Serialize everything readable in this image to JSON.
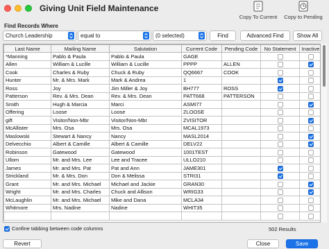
{
  "window": {
    "title": "Giving Unit Field Maintenance"
  },
  "toolbar": {
    "copy_current": "Copy To Current",
    "copy_pending": "Copy to Pending"
  },
  "find": {
    "label": "Find Records Where",
    "field": "Church Leadership",
    "operator": "equal to",
    "value": "(0 selected)",
    "find_button": "Find",
    "advanced_button": "Advanced Find",
    "show_all_button": "Show All"
  },
  "columns": [
    "Last Name",
    "Mailing Name",
    "Salutation",
    "Current Code",
    "Pending Code",
    "No Statement",
    "Inactive"
  ],
  "rows": [
    {
      "last": "*Manning",
      "mailing": "Pablo & Paula",
      "salutation": "Pablo & Paula",
      "current": "GAGE",
      "pending": "",
      "nostmt": false,
      "inactive": false
    },
    {
      "last": "Allen",
      "mailing": "William & Lucille",
      "salutation": "William & Lucille",
      "current": "PPPP",
      "pending": "ALLEN",
      "nostmt": false,
      "inactive": true
    },
    {
      "last": "Cook",
      "mailing": "Charles & Ruby",
      "salutation": "Chuck & Ruby",
      "current": "QQ6667",
      "pending": "COOK",
      "nostmt": false,
      "inactive": false
    },
    {
      "last": "Hunter",
      "mailing": "Mr. & Mrs. Mark",
      "salutation": "Mark & Andrea",
      "current": "1",
      "pending": "",
      "nostmt": true,
      "inactive": false
    },
    {
      "last": "Ross",
      "mailing": "Joy",
      "salutation": "Jim Miller & Joy",
      "current": "BH777",
      "pending": "ROSS",
      "nostmt": true,
      "inactive": false
    },
    {
      "last": "Patterson",
      "mailing": "Rev. & Mrs. Dean",
      "salutation": "Rev. & Mrs. Dean",
      "current": "PATT668",
      "pending": "PATTERSON",
      "nostmt": false,
      "inactive": false
    },
    {
      "last": "Smith",
      "mailing": "Hugh & Marcia",
      "salutation": "Marci",
      "current": "ASMI77",
      "pending": "",
      "nostmt": false,
      "inactive": true
    },
    {
      "last": "Offering",
      "mailing": "Loose",
      "salutation": "Loose",
      "current": "ZLOOSE",
      "pending": "",
      "nostmt": false,
      "inactive": false
    },
    {
      "last": "gift",
      "mailing": "Visitor/Non-Mbr",
      "salutation": "Visitor/Non-Mbr",
      "current": "ZVISITOR",
      "pending": "",
      "nostmt": false,
      "inactive": true
    },
    {
      "last": "McAllister",
      "mailing": "Mrs. Osa",
      "salutation": "Mrs. Osa",
      "current": "MCAL1973",
      "pending": "",
      "nostmt": false,
      "inactive": false
    },
    {
      "last": "Maslowski",
      "mailing": "Stewart & Nancy",
      "salutation": "Nancy",
      "current": "MASL2014",
      "pending": "",
      "nostmt": false,
      "inactive": true
    },
    {
      "last": "Delvecchio",
      "mailing": "Albert & Camille",
      "salutation": "Albert & Camille",
      "current": "DELV22",
      "pending": "",
      "nostmt": false,
      "inactive": true
    },
    {
      "last": "Robinson",
      "mailing": "Gatewood",
      "salutation": "Gatewood",
      "current": "1001TEST",
      "pending": "",
      "nostmt": false,
      "inactive": false
    },
    {
      "last": "Ullom",
      "mailing": "Mr. and Mrs. Lee",
      "salutation": "Lee and Tracee",
      "current": "ULLO210",
      "pending": "",
      "nostmt": false,
      "inactive": false
    },
    {
      "last": "James",
      "mailing": "Mr. and Mrs. Pat",
      "salutation": "Pat and Ann",
      "current": "JAME301",
      "pending": "",
      "nostmt": true,
      "inactive": false
    },
    {
      "last": "Strickland",
      "mailing": "Mr. & Mrs. Don",
      "salutation": "Don & Melissa",
      "current": "STRI31",
      "pending": "",
      "nostmt": true,
      "inactive": false
    },
    {
      "last": "Grant",
      "mailing": "Mr. and Mrs. Michael",
      "salutation": "Michael and Jackie",
      "current": "GRAN30",
      "pending": "",
      "nostmt": false,
      "inactive": true
    },
    {
      "last": "Wright",
      "mailing": "Mr. and Mrs. Charles",
      "salutation": "Chuck and Allison",
      "current": "WRIG33",
      "pending": "",
      "nostmt": false,
      "inactive": true
    },
    {
      "last": "McLaughlin",
      "mailing": "Mr. and Mrs. Michael",
      "salutation": "Mike and Dana",
      "current": "MCLA34",
      "pending": "",
      "nostmt": false,
      "inactive": false
    },
    {
      "last": "Whitmore",
      "mailing": "Mrs. Nadine",
      "salutation": "Nadine",
      "current": "WHIT35",
      "pending": "",
      "nostmt": false,
      "inactive": false
    },
    {
      "last": "",
      "mailing": "",
      "salutation": "",
      "current": "",
      "pending": "",
      "nostmt": false,
      "inactive": false
    }
  ],
  "confine_label": "Confine tabbing between code columns",
  "confine_checked": true,
  "results": "502 Results",
  "buttons": {
    "revert": "Revert",
    "close": "Close",
    "save": "Save"
  },
  "colors": {
    "accent": "#1a73e8"
  }
}
